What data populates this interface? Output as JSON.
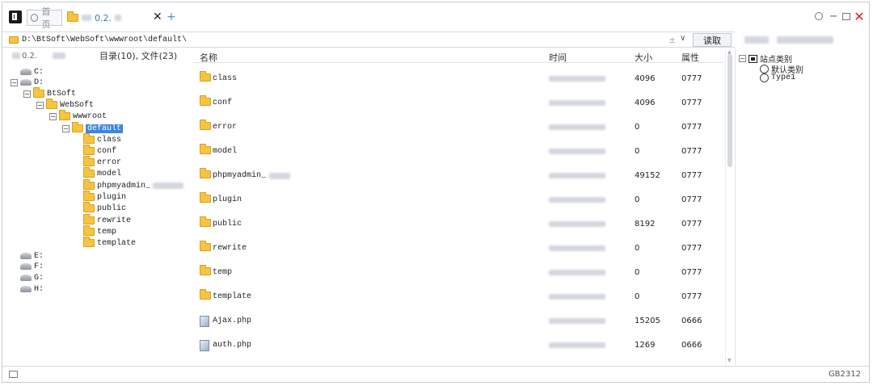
{
  "titlebar": {
    "home_tab": "首页",
    "folder_tab": "0.2.",
    "close_glyph": "✕",
    "add_glyph": "+"
  },
  "window_controls": {
    "minimize": "−",
    "close": "✕"
  },
  "address": {
    "path": "D:\\BtSoft\\WebSoft\\wwwroot\\default\\",
    "clear_glyph": "±",
    "dropdown_glyph": "∨",
    "read_label": "读取"
  },
  "left_panel": {
    "header_path": "0.2.",
    "header_count": "目录(10), 文件(23)",
    "tree": [
      {
        "label": "C:",
        "kind": "drive",
        "depth": 0,
        "toggle": ""
      },
      {
        "label": "D:",
        "kind": "drive",
        "depth": 0,
        "toggle": "−"
      },
      {
        "label": "BtSoft",
        "kind": "folder",
        "depth": 1,
        "toggle": "−"
      },
      {
        "label": "WebSoft",
        "kind": "folder",
        "depth": 2,
        "toggle": "−"
      },
      {
        "label": "wwwroot",
        "kind": "folder",
        "depth": 3,
        "toggle": "−"
      },
      {
        "label": "default",
        "kind": "folder",
        "depth": 4,
        "toggle": "−",
        "selected": true
      },
      {
        "label": "class",
        "kind": "folder",
        "depth": 5,
        "toggle": ""
      },
      {
        "label": "conf",
        "kind": "folder",
        "depth": 5,
        "toggle": ""
      },
      {
        "label": "error",
        "kind": "folder",
        "depth": 5,
        "toggle": ""
      },
      {
        "label": "model",
        "kind": "folder",
        "depth": 5,
        "toggle": ""
      },
      {
        "label": "phpmyadmin_",
        "kind": "folder",
        "depth": 5,
        "toggle": "",
        "blurred_suffix": true
      },
      {
        "label": "plugin",
        "kind": "folder",
        "depth": 5,
        "toggle": ""
      },
      {
        "label": "public",
        "kind": "folder",
        "depth": 5,
        "toggle": ""
      },
      {
        "label": "rewrite",
        "kind": "folder",
        "depth": 5,
        "toggle": ""
      },
      {
        "label": "temp",
        "kind": "folder",
        "depth": 5,
        "toggle": ""
      },
      {
        "label": "template",
        "kind": "folder",
        "depth": 5,
        "toggle": ""
      },
      {
        "label": "E:",
        "kind": "drive",
        "depth": 0,
        "toggle": ""
      },
      {
        "label": "F:",
        "kind": "drive",
        "depth": 0,
        "toggle": ""
      },
      {
        "label": "G:",
        "kind": "drive",
        "depth": 0,
        "toggle": ""
      },
      {
        "label": "H:",
        "kind": "drive",
        "depth": 0,
        "toggle": ""
      }
    ]
  },
  "file_list": {
    "columns": {
      "name": "名称",
      "time": "时间",
      "size": "大小",
      "attr": "属性"
    },
    "rows": [
      {
        "name": "class",
        "kind": "folder",
        "size": "4096",
        "attr": "0777"
      },
      {
        "name": "conf",
        "kind": "folder",
        "size": "4096",
        "attr": "0777"
      },
      {
        "name": "error",
        "kind": "folder",
        "size": "0",
        "attr": "0777"
      },
      {
        "name": "model",
        "kind": "folder",
        "size": "0",
        "attr": "0777"
      },
      {
        "name": "phpmyadmin_",
        "kind": "folder",
        "size": "49152",
        "attr": "0777",
        "blurred_suffix": true
      },
      {
        "name": "plugin",
        "kind": "folder",
        "size": "0",
        "attr": "0777"
      },
      {
        "name": "public",
        "kind": "folder",
        "size": "8192",
        "attr": "0777"
      },
      {
        "name": "rewrite",
        "kind": "folder",
        "size": "0",
        "attr": "0777"
      },
      {
        "name": "temp",
        "kind": "folder",
        "size": "0",
        "attr": "0777"
      },
      {
        "name": "template",
        "kind": "folder",
        "size": "0",
        "attr": "0777"
      },
      {
        "name": "Ajax.php",
        "kind": "file",
        "size": "15205",
        "attr": "0666"
      },
      {
        "name": "auth.php",
        "kind": "file",
        "size": "1269",
        "attr": "0666"
      }
    ]
  },
  "category_panel": {
    "root_toggle": "−",
    "root_label": "站点类别",
    "items": [
      "默认类别",
      "Type1"
    ]
  },
  "statusbar": {
    "encoding": "GB2312"
  },
  "colors": {
    "selection": "#3b86e0",
    "folder": "#f6c343",
    "close_red": "#e02020",
    "accent_blue": "#4a90e2"
  }
}
